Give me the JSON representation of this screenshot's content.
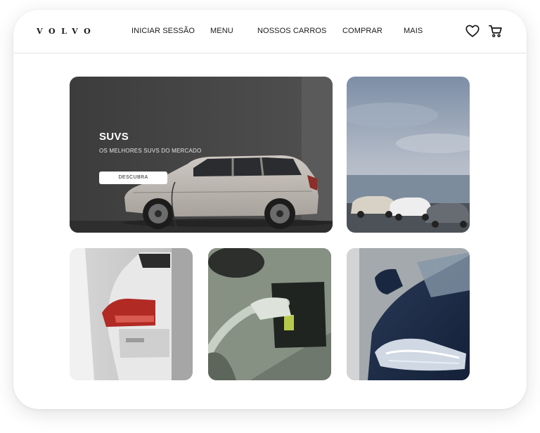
{
  "brand": {
    "logo": "VOLVO"
  },
  "nav": {
    "links": [
      "INICIAR SESSÃO",
      "MENU",
      "NOSSOS CARROS",
      "COMPRAR",
      "MAIS"
    ],
    "icons": [
      "heart-icon",
      "cart-icon"
    ]
  },
  "hero": {
    "title": "SUVS",
    "subtitle": "OS MELHORES SUVS DO MERCADO",
    "button_label": "DESCUBRA"
  },
  "colors": {
    "hero_background": "#4a4a4a",
    "nav_text": "#1a1a1a",
    "button_background": "#ffffff"
  }
}
